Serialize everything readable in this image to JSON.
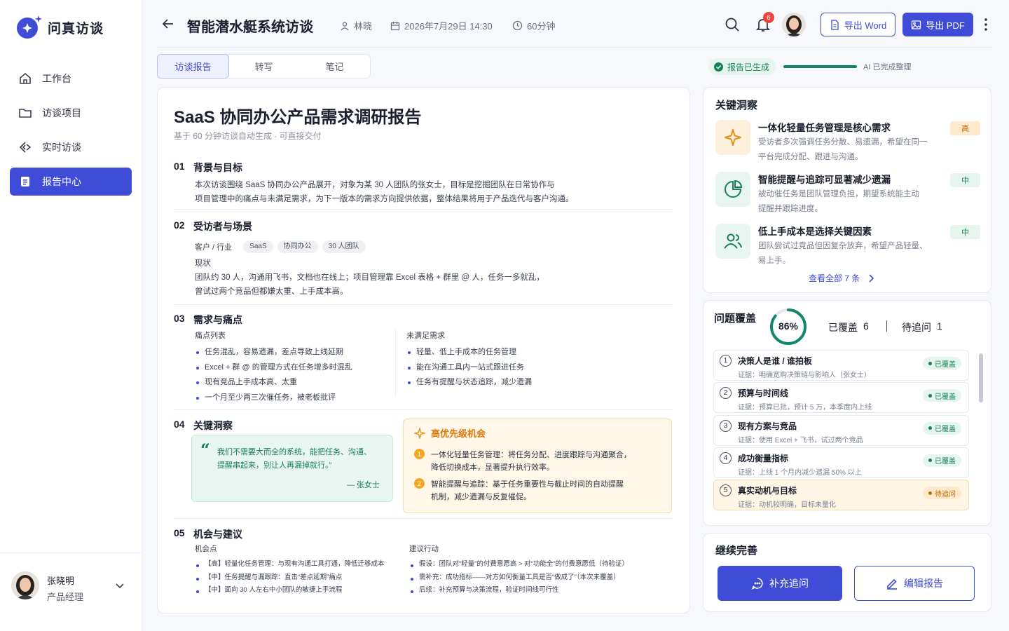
{
  "app": {
    "name": "问真访谈"
  },
  "nav": [
    {
      "label": "工作台",
      "icon": "home-icon"
    },
    {
      "label": "访谈项目",
      "icon": "folder-icon"
    },
    {
      "label": "实时访谈",
      "icon": "live-interview-icon"
    },
    {
      "label": "报告中心",
      "icon": "report-icon",
      "active": true
    }
  ],
  "user": {
    "name": "张晓明",
    "role": "产品经理"
  },
  "header": {
    "title": "智能潜水艇系统访谈",
    "interviewer": "林晓",
    "datetime": "2026年7月29日 14:30",
    "duration": "60分钟",
    "notification_count": "6",
    "export_word": "导出 Word",
    "export_pdf": "导出 PDF"
  },
  "tabs": [
    "访谈报告",
    "转写",
    "笔记"
  ],
  "status": {
    "label": "报告已生成",
    "progress": 1.0,
    "text": "AI 已完成整理"
  },
  "report": {
    "title": "SaaS 协同办公产品需求调研报告",
    "subtitle": "基于 60 分钟访谈自动生成 · 可直接交付",
    "s1": {
      "no": "01",
      "title": "背景与目标",
      "line1": "本次访谈围绕 SaaS 协同办公产品展开，对象为某 30 人团队的张女士，目标是挖掘团队在日常协作与",
      "line2": "项目管理中的痛点与未满足需求，为下一版本的需求方向提供依据，整体结果将用于产品迭代与客户沟通。"
    },
    "s2": {
      "no": "02",
      "title": "受访者与场景",
      "client_label": "客户 / 行业",
      "tags": [
        "SaaS",
        "协同办公",
        "30 人团队"
      ],
      "status_label": "现状",
      "line1": "团队约 30 人，沟通用飞书，文档也在线上；项目管理靠 Excel 表格 + 群里 @ 人，任务一多就乱，",
      "line2": "曾试过两个竞品但都嫌太重、上手成本高。"
    },
    "s3": {
      "no": "03",
      "title": "需求与痛点",
      "pain_label": "痛点列表",
      "pains": [
        "任务混乱，容易遗漏，差点导致上线延期",
        "Excel + 群 @ 的管理方式在任务增多时混乱",
        "现有竞品上手成本高、太重",
        "一个月至少两三次催任务，被老板批评"
      ],
      "need_label": "未满足需求",
      "needs": [
        "轻量、低上手成本的任务管理",
        "能在沟通工具内一站式跟进任务",
        "任务有提醒与状态追踪，减少遗漏"
      ]
    },
    "s4": {
      "no": "04",
      "title": "关键洞察",
      "quote_line1": "我们不需要大而全的系统，能把任务、沟通、",
      "quote_line2": "提醒串起来，别让人再漏掉就行。”",
      "quote_author": "— 张女士",
      "opp_title": "高优先级机会",
      "opps": [
        {
          "n": "1",
          "l1": "一体化轻量任务管理：将任务分配、进度跟踪与沟通聚合，",
          "l2": "降低切换成本，显著提升执行效率。"
        },
        {
          "n": "2",
          "l1": "智能提醒与追踪：基于任务重要性与截止时间的自动提醒",
          "l2": "机制，减少遗漏与反复催促。"
        }
      ]
    },
    "s5": {
      "no": "05",
      "title": "机会与建议",
      "opp_label": "机会点",
      "opps": [
        "【高】轻量化任务管理：与现有沟通工具打通，降低迁移成本",
        "【中】任务提醒与漏跟踪：直击“差点延期”痛点",
        "【中】面向 30 人左右中小团队的敏捷上手流程"
      ],
      "act_label": "建议行动",
      "acts": [
        "假设：团队对“轻量”的付费意愿高 > 对“功能全”的付费意愿低（待验证）",
        "需补充：成功指标——对方如何衡量工具是否“做成了”（本次未覆盖）",
        "后续：补充预算与决策流程，验证时间线可行性"
      ]
    }
  },
  "insights": {
    "title": "关键洞察",
    "items": [
      {
        "title": "一体化轻量任务管理是核心需求",
        "desc1": "受访者多次强调任务分散、易遗漏，希望在同一",
        "desc2": "平台完成分配、跟进与沟通。",
        "level": "高",
        "icon": "sparkle-icon"
      },
      {
        "title": "智能提醒与追踪可显著减少遗漏",
        "desc1": "被动催任务是团队管理负担，期望系统能主动",
        "desc2": "提醒并跟踪进度。",
        "level": "中",
        "icon": "pie-chart-icon"
      },
      {
        "title": "低上手成本是选择关键因素",
        "desc1": "团队尝试过竞品但因复杂放弃，希望产品轻量、",
        "desc2": "易上手。",
        "level": "中",
        "icon": "users-icon"
      }
    ],
    "view_all": "查看全部 7 条"
  },
  "coverage": {
    "title": "问题覆盖",
    "percent": "86%",
    "ratio": 0.86,
    "covered_label": "已覆盖",
    "covered": "6",
    "pending_label": "待追问",
    "pending": "1",
    "items": [
      {
        "n": "1",
        "title": "决策人是谁 / 谁拍板",
        "evidence": "证据：明确宽购决策链与影响人（张女士）",
        "status": "已覆盖"
      },
      {
        "n": "2",
        "title": "预算与时间线",
        "evidence": "证据：预算已批，预计 5 万，本季度内上线",
        "status": "已覆盖"
      },
      {
        "n": "3",
        "title": "现有方案与竞品",
        "evidence": "证据：使用 Excel + 飞书，试过两个竞品",
        "status": "已覆盖"
      },
      {
        "n": "4",
        "title": "成功衡量指标",
        "evidence": "证据：上线 1 个月内减少遗漏 50% 以上",
        "status": "已覆盖"
      },
      {
        "n": "5",
        "title": "真实动机与目标",
        "evidence": "证据：动机较明确，目标未量化",
        "status": "待追问"
      }
    ]
  },
  "continue": {
    "title": "继续完善",
    "followup": "补充追问",
    "edit": "编辑报告"
  }
}
